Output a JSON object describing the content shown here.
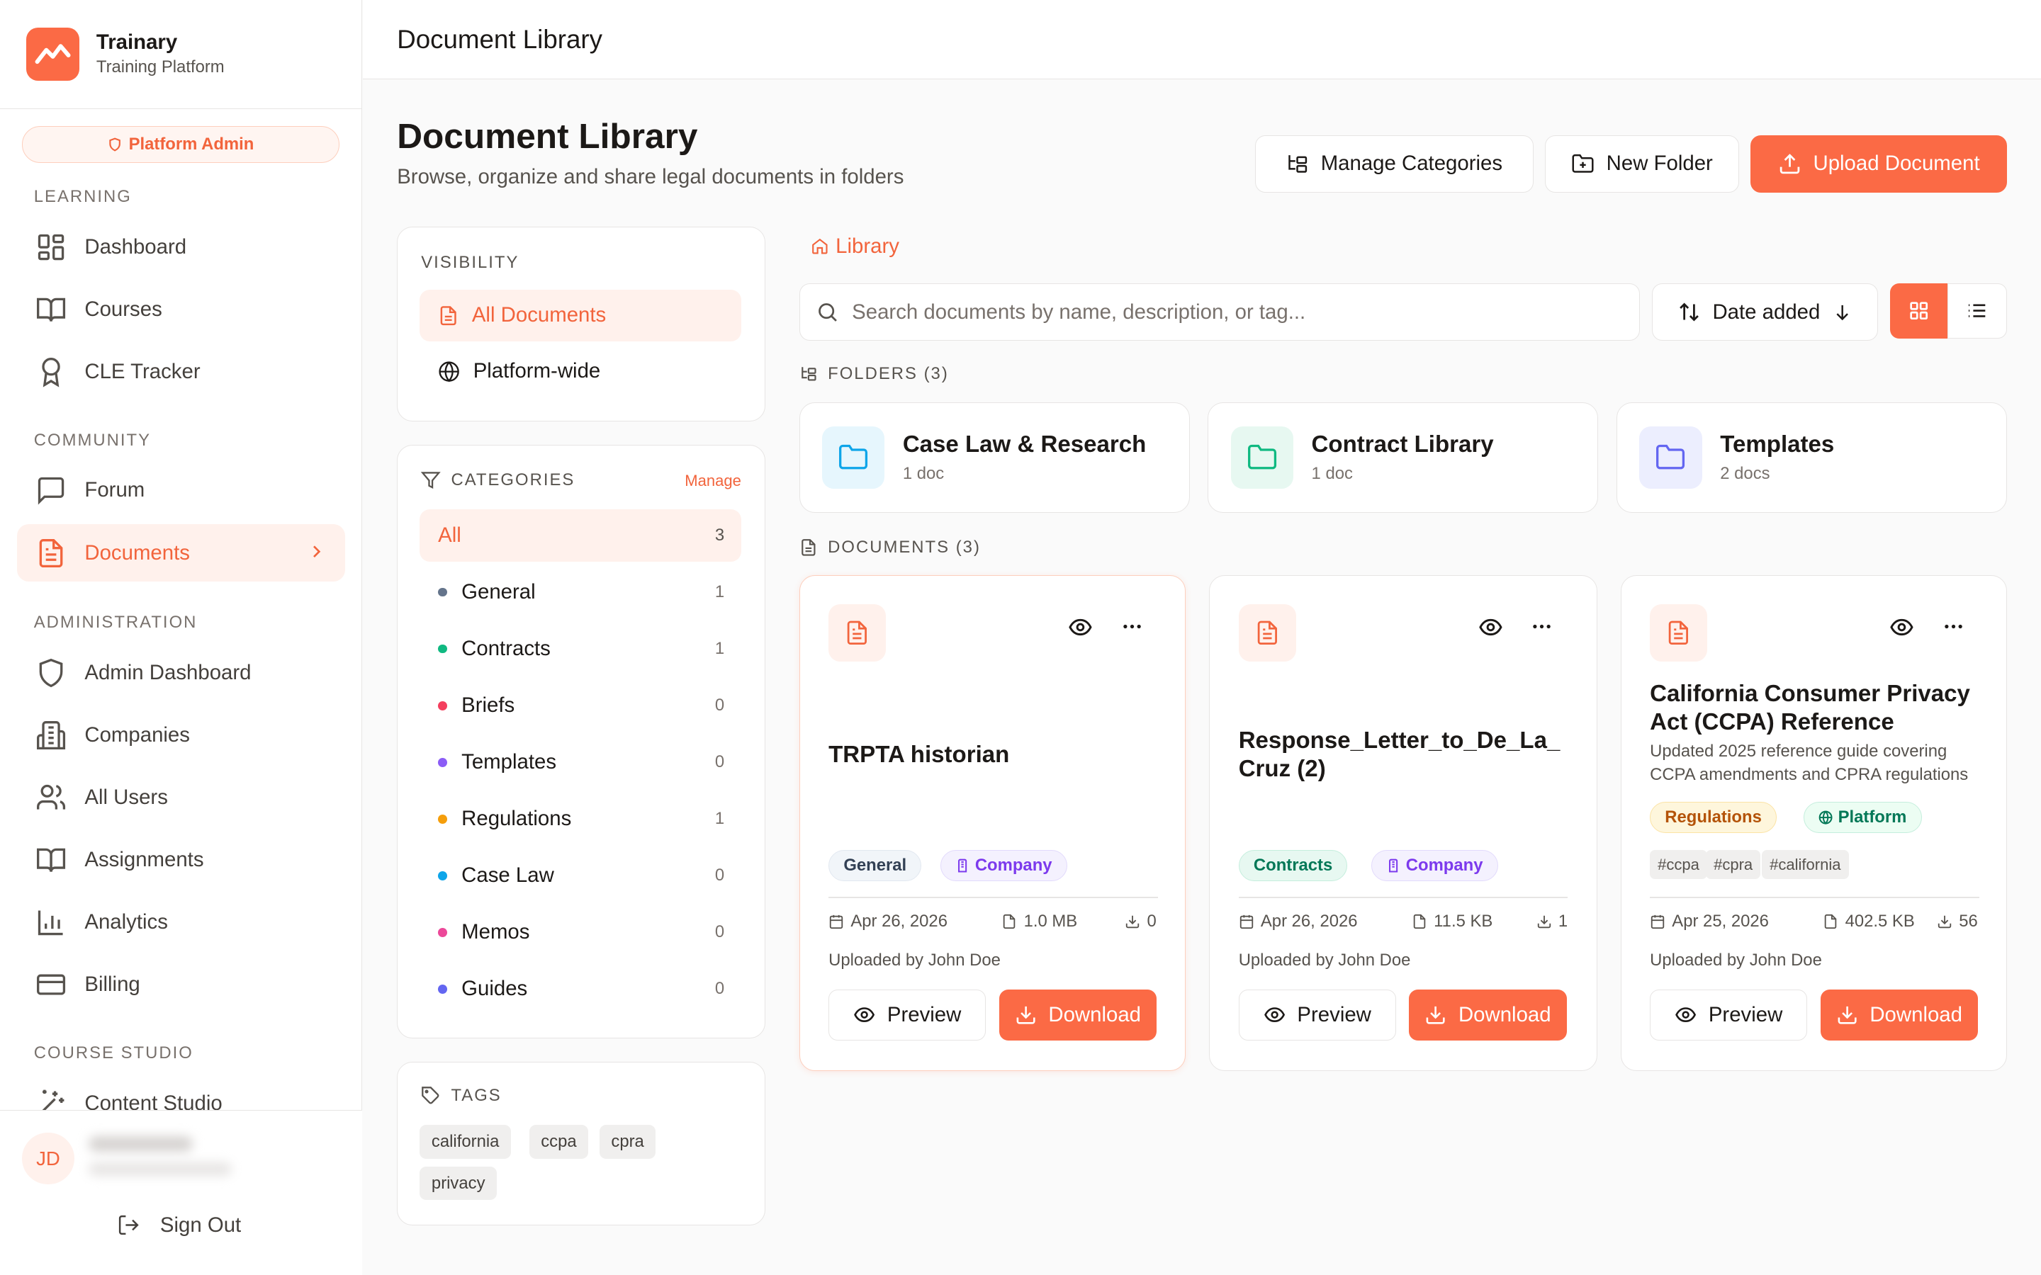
{
  "brand": {
    "name": "Trainary",
    "subtitle": "Training Platform"
  },
  "role_badge": "Platform Admin",
  "nav": {
    "learning": {
      "title": "LEARNING",
      "items": [
        {
          "label": "Dashboard",
          "icon": "dashboard-icon"
        },
        {
          "label": "Courses",
          "icon": "book-icon"
        },
        {
          "label": "CLE Tracker",
          "icon": "award-icon"
        }
      ]
    },
    "community": {
      "title": "COMMUNITY",
      "items": [
        {
          "label": "Forum",
          "icon": "chat-icon"
        },
        {
          "label": "Documents",
          "icon": "document-icon",
          "active": true
        }
      ]
    },
    "administration": {
      "title": "ADMINISTRATION",
      "items": [
        {
          "label": "Admin Dashboard",
          "icon": "shield-icon"
        },
        {
          "label": "Companies",
          "icon": "building-icon"
        },
        {
          "label": "All Users",
          "icon": "users-icon"
        },
        {
          "label": "Assignments",
          "icon": "book-icon"
        },
        {
          "label": "Analytics",
          "icon": "chart-icon"
        },
        {
          "label": "Billing",
          "icon": "card-icon"
        }
      ]
    },
    "course_studio": {
      "title": "COURSE STUDIO",
      "items": [
        {
          "label": "Content Studio",
          "icon": "wand-icon"
        }
      ]
    }
  },
  "user": {
    "initials": "JD",
    "sign_out": "Sign Out"
  },
  "topbar_title": "Document Library",
  "page": {
    "title": "Document Library",
    "subtitle": "Browse, organize and share legal documents in folders"
  },
  "actions": {
    "manage_categories": "Manage Categories",
    "new_folder": "New Folder",
    "upload": "Upload Document"
  },
  "visibility": {
    "title": "VISIBILITY",
    "items": [
      "All Documents",
      "Platform-wide"
    ]
  },
  "categories": {
    "title": "CATEGORIES",
    "manage": "Manage",
    "items": [
      {
        "label": "All",
        "count": "3",
        "color": ""
      },
      {
        "label": "General",
        "count": "1",
        "color": "#64748b"
      },
      {
        "label": "Contracts",
        "count": "1",
        "color": "#10b981"
      },
      {
        "label": "Briefs",
        "count": "0",
        "color": "#f43f5e"
      },
      {
        "label": "Templates",
        "count": "0",
        "color": "#8b5cf6"
      },
      {
        "label": "Regulations",
        "count": "1",
        "color": "#f59e0b"
      },
      {
        "label": "Case Law",
        "count": "0",
        "color": "#0ea5e9"
      },
      {
        "label": "Memos",
        "count": "0",
        "color": "#ec4899"
      },
      {
        "label": "Guides",
        "count": "0",
        "color": "#6366f1"
      }
    ]
  },
  "tags": {
    "title": "TAGS",
    "items": [
      "california",
      "ccpa",
      "cpra",
      "privacy"
    ]
  },
  "breadcrumb": "Library",
  "search": {
    "placeholder": "Search documents by name, description, or tag..."
  },
  "sort": {
    "label": "Date added"
  },
  "folders": {
    "title": "FOLDERS (3)",
    "items": [
      {
        "name": "Case Law & Research",
        "count": "1 doc",
        "color": "#0ea5e9",
        "bg": "#e6f6fd"
      },
      {
        "name": "Contract Library",
        "count": "1 doc",
        "color": "#10b981",
        "bg": "#e7f8f1"
      },
      {
        "name": "Templates",
        "count": "2 docs",
        "color": "#6366f1",
        "bg": "#eceefe"
      }
    ]
  },
  "documents": {
    "title": "DOCUMENTS (3)",
    "items": [
      {
        "title": "TRPTA historian",
        "description": "",
        "category": "General",
        "visibility": "Company",
        "tags": [],
        "date": "Apr 26, 2026",
        "size": "1.0 MB",
        "downloads": "0",
        "uploader": "Uploaded by John Doe",
        "preview": "Preview",
        "download": "Download"
      },
      {
        "title": "Response_Letter_to_De_La_Cruz (2)",
        "description": "",
        "category": "Contracts",
        "visibility": "Company",
        "tags": [],
        "date": "Apr 26, 2026",
        "size": "11.5 KB",
        "downloads": "1",
        "uploader": "Uploaded by John Doe",
        "preview": "Preview",
        "download": "Download"
      },
      {
        "title": "California Consumer Privacy Act (CCPA) Reference",
        "description": "Updated 2025 reference guide covering CCPA amendments and CPRA regulations",
        "category": "Regulations",
        "visibility": "Platform",
        "tags": [
          "#ccpa",
          "#cpra",
          "#california"
        ],
        "date": "Apr 25, 2026",
        "size": "402.5 KB",
        "downloads": "56",
        "uploader": "Uploaded by John Doe",
        "preview": "Preview",
        "download": "Download"
      }
    ]
  }
}
